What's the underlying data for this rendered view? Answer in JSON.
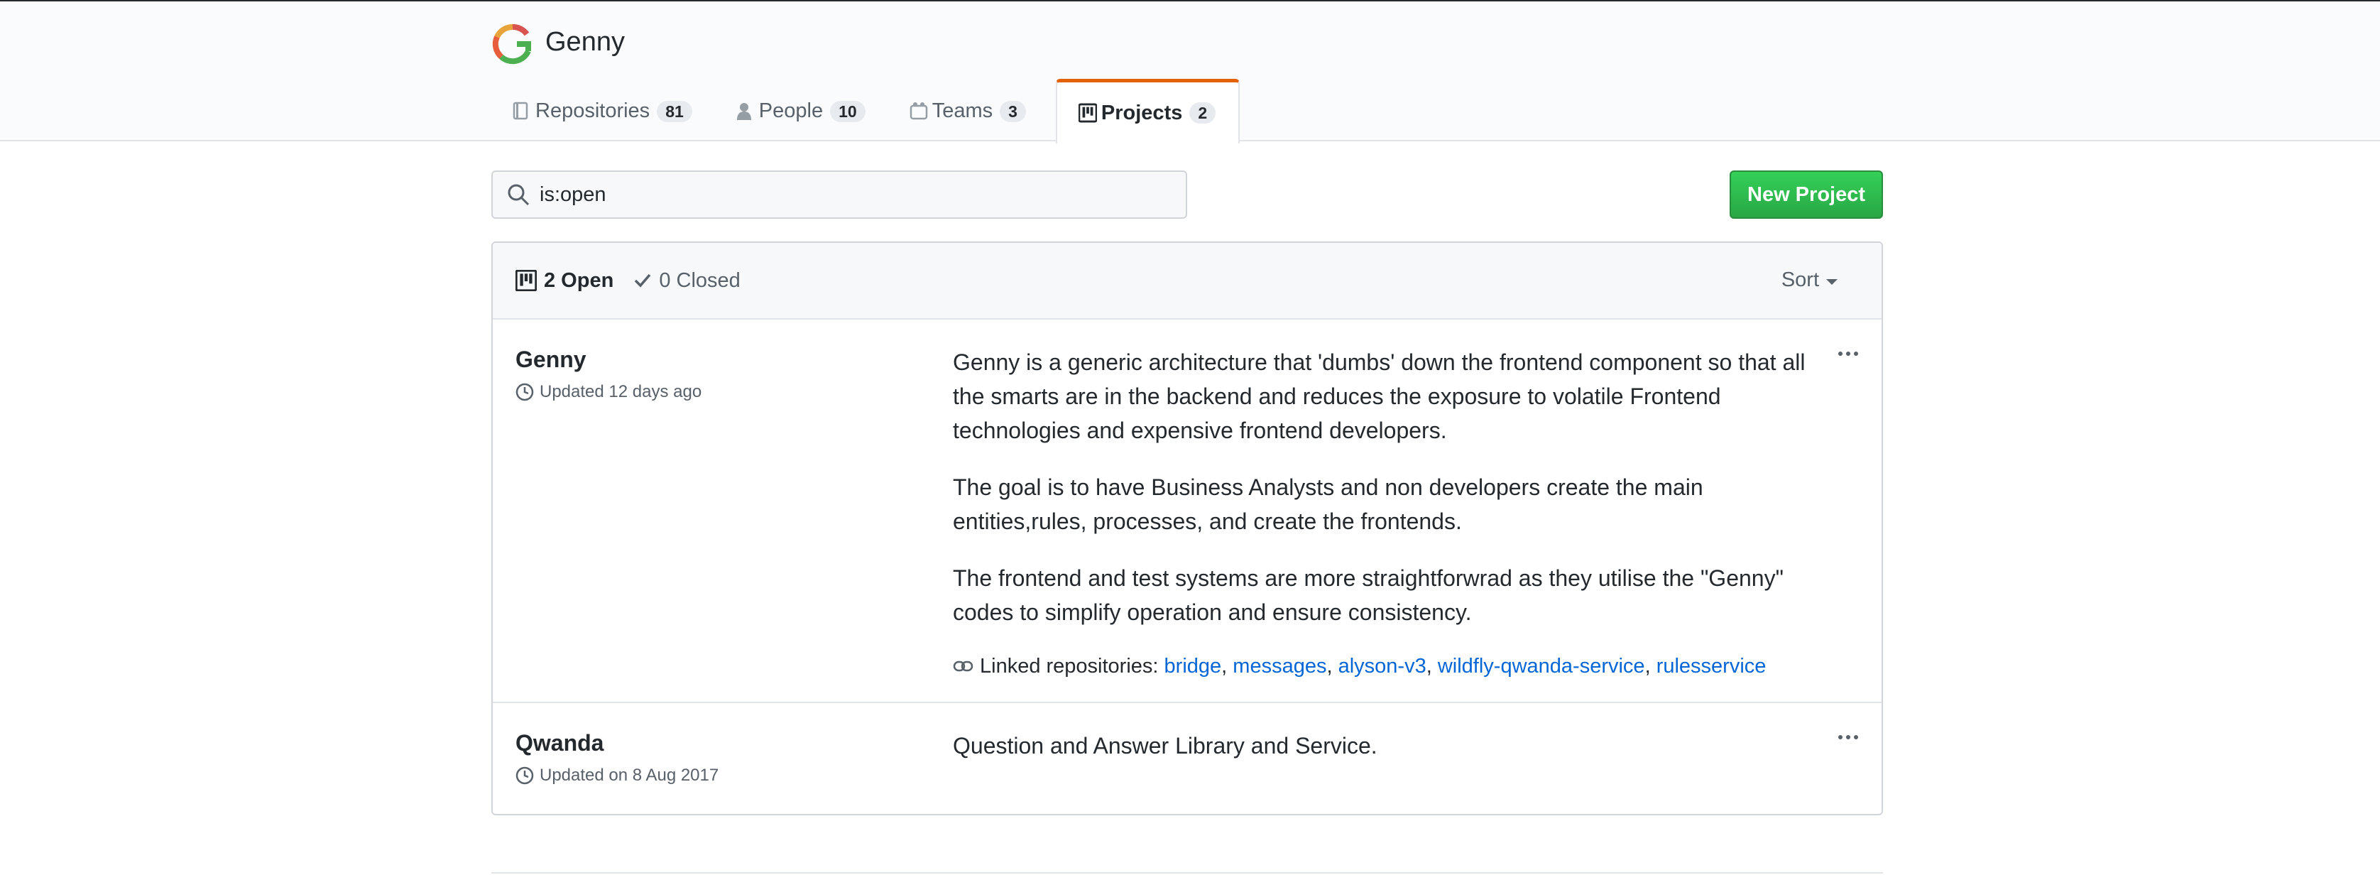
{
  "org": {
    "name": "Genny"
  },
  "tabs": [
    {
      "label": "Repositories",
      "count": "81",
      "icon": "repo-icon"
    },
    {
      "label": "People",
      "count": "10",
      "icon": "person-icon"
    },
    {
      "label": "Teams",
      "count": "3",
      "icon": "team-icon"
    },
    {
      "label": "Projects",
      "count": "2",
      "icon": "project-icon",
      "selected": true
    }
  ],
  "search": {
    "value": "is:open",
    "icon": "search-icon"
  },
  "new_project_label": "New Project",
  "filters": {
    "open": "2 Open",
    "closed": "0 Closed",
    "sort": "Sort"
  },
  "projects": [
    {
      "name": "Genny",
      "updated": "Updated 12 days ago",
      "paragraphs": [
        "Genny is a generic architecture that 'dumbs' down the frontend component so that all the smarts are in the backend and reduces the exposure to volatile Frontend technologies and expensive frontend developers.",
        "The goal is to have Business Analysts and non developers create the main entities,rules, processes, and create the frontends.",
        "The frontend and test systems are more straightforwrad as they utilise the \"Genny\" codes to simplify operation and ensure consistency."
      ],
      "linked_label": "Linked repositories:",
      "linked_repos": [
        "bridge",
        "messages",
        "alyson-v3",
        "wildfly-qwanda-service",
        "rulesservice"
      ]
    },
    {
      "name": "Qwanda",
      "updated": "Updated on 8 Aug 2017",
      "paragraphs": [
        "Question and Answer Library and Service."
      ]
    }
  ],
  "colors": {
    "accent_tab": "#e36209",
    "link": "#0366d6",
    "button_green": "#28a745"
  }
}
